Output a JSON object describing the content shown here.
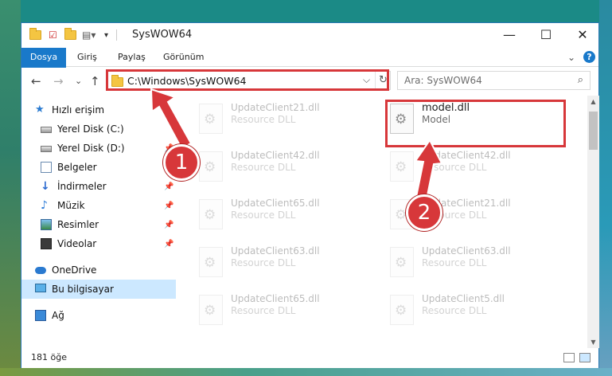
{
  "window": {
    "title": "SysWOW64",
    "controls": {
      "minimize": "—",
      "maximize": "☐",
      "close": "✕"
    }
  },
  "ribbon": {
    "tabs": [
      "Dosya",
      "Giriş",
      "Paylaş",
      "Görünüm"
    ],
    "expand_glyph": "⌄",
    "help": "?"
  },
  "address": {
    "path": "C:\\Windows\\SysWOW64",
    "dropdown_glyph": "⌵",
    "refresh_glyph": "↻",
    "back": "←",
    "forward": "→",
    "recent": "⌄",
    "up": "↑"
  },
  "search": {
    "placeholder": "Ara: SysWOW64",
    "icon": "⌕"
  },
  "nav": {
    "quick_access": "Hızlı erişim",
    "items": [
      {
        "label": "Yerel Disk (C:)",
        "icon": "drive-icon"
      },
      {
        "label": "Yerel Disk (D:)",
        "icon": "drive-icon"
      },
      {
        "label": "Belgeler",
        "icon": "documents-icon"
      },
      {
        "label": "İndirmeler",
        "icon": "downloads-icon"
      },
      {
        "label": "Müzik",
        "icon": "music-icon"
      },
      {
        "label": "Resimler",
        "icon": "pictures-icon"
      },
      {
        "label": "Videolar",
        "icon": "videos-icon"
      }
    ],
    "pin_glyph": "📌",
    "onedrive": "OneDrive",
    "this_pc": "Bu bilgisayar",
    "network": "Ağ"
  },
  "files": {
    "left_column": [
      {
        "name": "UpdateClient21.dll",
        "type": "Resource DLL"
      },
      {
        "name": "UpdateClient42.dll",
        "type": "Resource DLL"
      },
      {
        "name": "UpdateClient65.dll",
        "type": "Resource DLL"
      },
      {
        "name": "UpdateClient63.dll",
        "type": "Resource DLL"
      },
      {
        "name": "UpdateClient65.dll",
        "type": "Resource DLL"
      }
    ],
    "right_column": [
      {
        "name": "model.dll",
        "type": "Model"
      },
      {
        "name": "UpdateClient42.dll",
        "type": "Resource DLL"
      },
      {
        "name": "UpdateClient21.dll",
        "type": "Resource DLL"
      },
      {
        "name": "UpdateClient63.dll",
        "type": "Resource DLL"
      },
      {
        "name": "UpdateClient5.dll",
        "type": "Resource DLL"
      }
    ]
  },
  "status": {
    "item_count": "181 öğe"
  },
  "callouts": {
    "step1": "1",
    "step2": "2",
    "color": "#d7373a"
  },
  "colors": {
    "accent": "#1979ca",
    "selection": "#cce8ff"
  }
}
